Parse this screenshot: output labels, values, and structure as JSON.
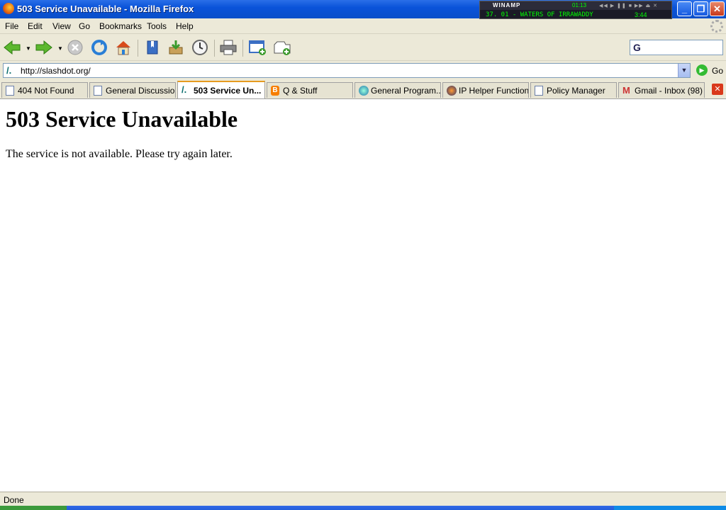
{
  "window": {
    "title": "503 Service Unavailable - Mozilla Firefox"
  },
  "winamp": {
    "name": "WINAMP",
    "time": "01:13",
    "track": "37. 01 - WATERS OF IRRAWADDY",
    "length": "3:44"
  },
  "menu": {
    "file": "File",
    "edit": "Edit",
    "view": "View",
    "go": "Go",
    "bookmarks": "Bookmarks",
    "tools": "Tools",
    "help": "Help"
  },
  "addressbar": {
    "url": "http://slashdot.org/",
    "go_label": "Go"
  },
  "tabs": [
    {
      "label": "404 Not Found",
      "icon": "page-icon"
    },
    {
      "label": "General Discussion",
      "icon": "page-icon"
    },
    {
      "label": "503 Service Un...",
      "icon": "slashdot-icon",
      "active": true
    },
    {
      "label": "Q & Stuff",
      "icon": "blogger-icon"
    },
    {
      "label": "General Program...",
      "icon": "globe-icon"
    },
    {
      "label": "IP Helper Functions",
      "icon": "iphelper-icon"
    },
    {
      "label": "Policy Manager",
      "icon": "page-icon"
    },
    {
      "label": "Gmail - Inbox (98)",
      "icon": "gmail-icon"
    }
  ],
  "page": {
    "heading": "503 Service Unavailable",
    "message": "The service is not available. Please try again later."
  },
  "status": {
    "text": "Done"
  },
  "colors": {
    "titlebar": "#0a53d9",
    "active_tab_accent": "#e69b20",
    "chrome": "#ece9d8"
  }
}
